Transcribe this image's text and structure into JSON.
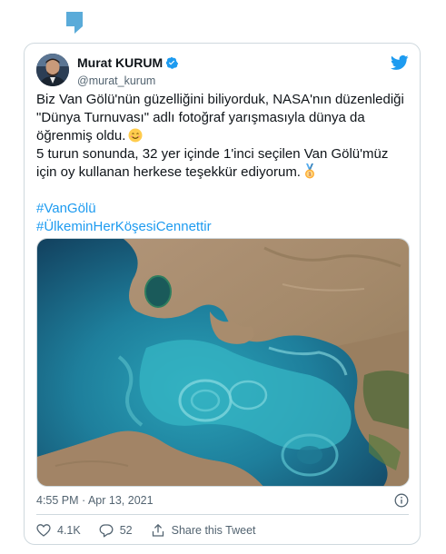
{
  "tweet": {
    "author": {
      "name": "Murat KURUM",
      "handle": "@murat_kurum",
      "verified": true
    },
    "text": {
      "line1": "Biz Van Gölü'nün güzelliğini biliyorduk, NASA'nın düzenlediği \"Dünya Turnuvası\" adlı fotoğraf yarışmasıyla dünya da öğrenmiş oldu.",
      "line1_emoji": "smiling-face-emoji",
      "line2": "5 turun sonunda, 32 yer içinde 1'inci seçilen Van Gölü'müz için oy kullanan herkese teşekkür ediyorum.",
      "line2_emoji": "first-place-medal-emoji",
      "hashtags": [
        "#VanGölü",
        "#ÜlkeminHerKöşesiCennettir"
      ]
    },
    "media": {
      "icon": "satellite-photo"
    },
    "timestamp": "4:55 PM · Apr 13, 2021",
    "actions": {
      "likes": "4.1K",
      "replies": "52",
      "share_label": "Share this Tweet"
    }
  },
  "colors": {
    "accent": "#1d9bf0",
    "text": "#0f1419",
    "secondary": "#536471",
    "border": "#cfd9de"
  }
}
